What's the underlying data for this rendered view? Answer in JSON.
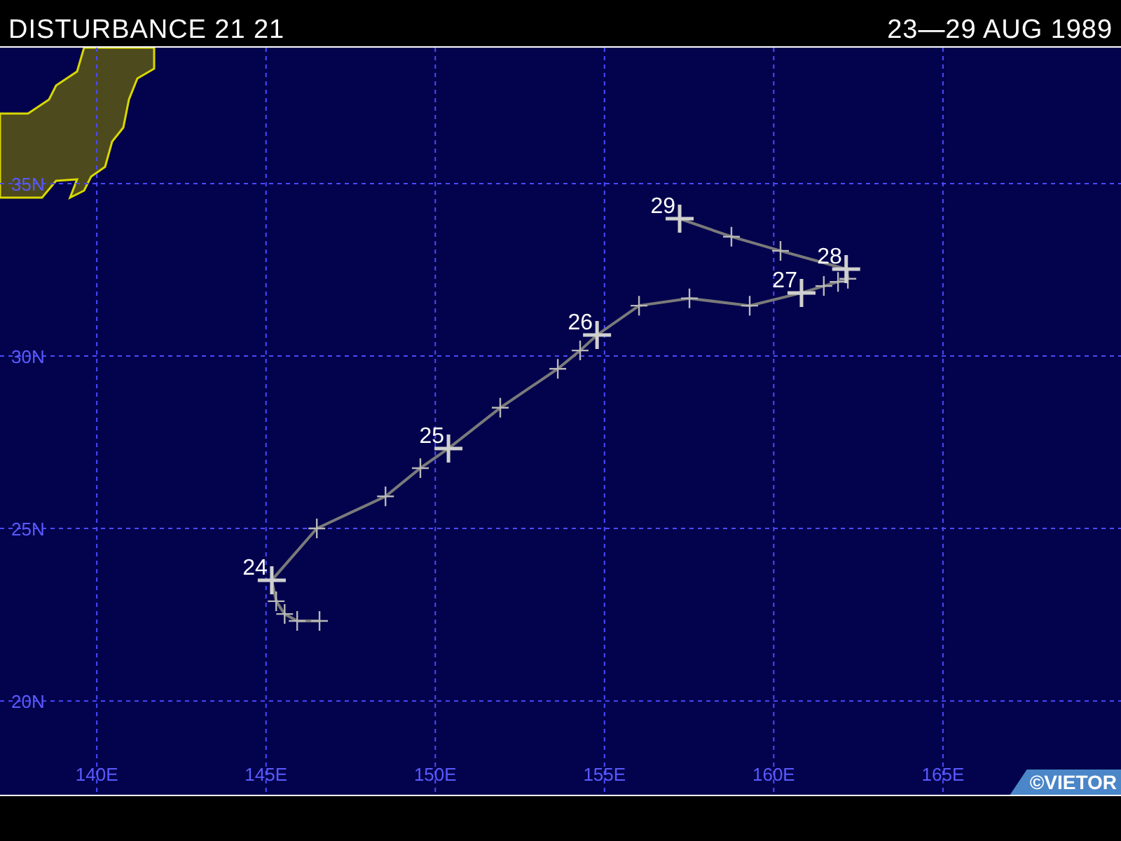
{
  "header": {
    "title": "DISTURBANCE 21 21",
    "date_range": "23—29 AUG 1989"
  },
  "map": {
    "chart_data": {
      "type": "line",
      "grid": true,
      "xlim": [
        137.14,
        170.26
      ],
      "ylim": [
        17.28,
        38.94
      ],
      "xticks": [
        {
          "value": 140,
          "label": "140E"
        },
        {
          "value": 145,
          "label": "145E"
        },
        {
          "value": 150,
          "label": "150E"
        },
        {
          "value": 155,
          "label": "155E"
        },
        {
          "value": 160,
          "label": "160E"
        },
        {
          "value": 165,
          "label": "165E"
        }
      ],
      "yticks": [
        {
          "value": 20,
          "label": "20N"
        },
        {
          "value": 25,
          "label": "25N"
        },
        {
          "value": 30,
          "label": "30N"
        },
        {
          "value": 35,
          "label": "35N"
        }
      ],
      "x": [
        146.58,
        145.92,
        145.55,
        145.3,
        145.17,
        146.5,
        148.53,
        149.56,
        150.39,
        151.92,
        153.62,
        154.28,
        154.78,
        156.02,
        157.51,
        159.29,
        160.82,
        161.48,
        161.9,
        162.19,
        162.14,
        160.2,
        158.75,
        157.22
      ],
      "series": [
        {
          "color": "#7a7a7a",
          "marker": "+",
          "values": [
            22.32,
            22.32,
            22.52,
            22.89,
            23.5,
            25.0,
            25.93,
            26.75,
            27.32,
            28.5,
            29.63,
            30.16,
            30.61,
            31.46,
            31.67,
            31.46,
            31.83,
            32.03,
            32.15,
            32.24,
            32.52,
            33.05,
            33.46,
            33.98
          ]
        }
      ],
      "annotations": [
        {
          "text": "24",
          "x": 145.17,
          "y": 23.5
        },
        {
          "text": "25",
          "x": 150.39,
          "y": 27.32
        },
        {
          "text": "26",
          "x": 154.78,
          "y": 30.61
        },
        {
          "text": "27",
          "x": 160.82,
          "y": 31.83
        },
        {
          "text": "28",
          "x": 162.14,
          "y": 32.52
        },
        {
          "text": "29",
          "x": 157.22,
          "y": 33.98
        }
      ]
    }
  },
  "credit": "©VIETOR"
}
